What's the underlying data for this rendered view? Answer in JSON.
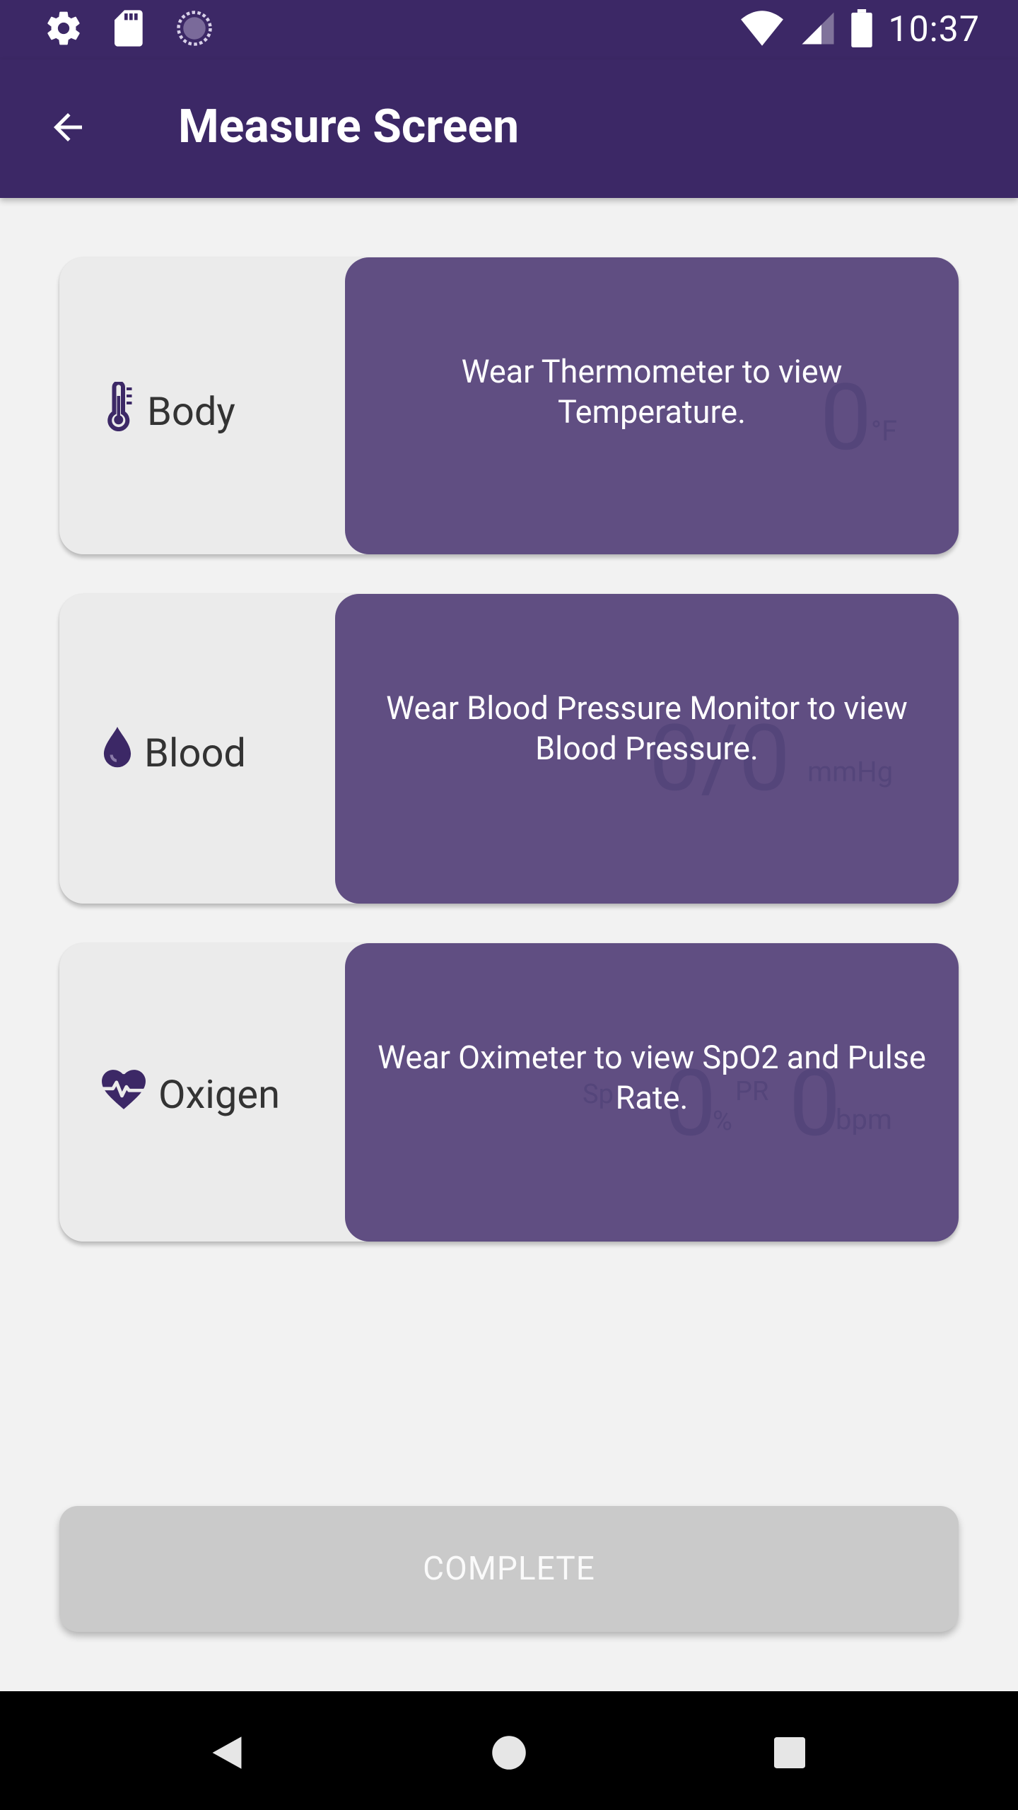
{
  "status_bar": {
    "time": "10:37",
    "left_icons": [
      "gear-icon",
      "sd-card-icon",
      "sync-circle-icon"
    ],
    "right_icons": [
      "wifi-icon",
      "cell-signal-icon",
      "battery-icon"
    ]
  },
  "app_bar": {
    "title": "Measure Screen",
    "back_icon": "arrow-left-icon"
  },
  "cards": {
    "body": {
      "label": "Body",
      "icon": "thermometer-icon",
      "value": "0",
      "unit": "°F",
      "message": "Wear Thermometer to view Temperature."
    },
    "blood": {
      "label": "Blood",
      "icon": "drop-icon",
      "value": "0/0",
      "unit": "mmHg",
      "message": "Wear Blood Pressure Monitor to view Blood Pressure."
    },
    "oxygen": {
      "label": "Oxigen",
      "icon": "heart-pulse-icon",
      "spo2_label": "Sp",
      "spo2_value": "0",
      "spo2_unit": "%",
      "pr_label": "PR",
      "pr_value": "0",
      "pr_unit": "bpm",
      "message": "Wear Oximeter to view SpO2 and Pulse Rate."
    }
  },
  "complete_button": {
    "label": "COMPLETE"
  },
  "nav_bar": {
    "icons": [
      "back-triangle-icon",
      "home-circle-icon",
      "recents-square-icon"
    ]
  },
  "colors": {
    "primary_dark": "#3c2866",
    "panel": "#604e82",
    "card_bg": "#ebebeb",
    "page_bg": "#f2f2f2",
    "disabled_button": "#cacaca"
  }
}
